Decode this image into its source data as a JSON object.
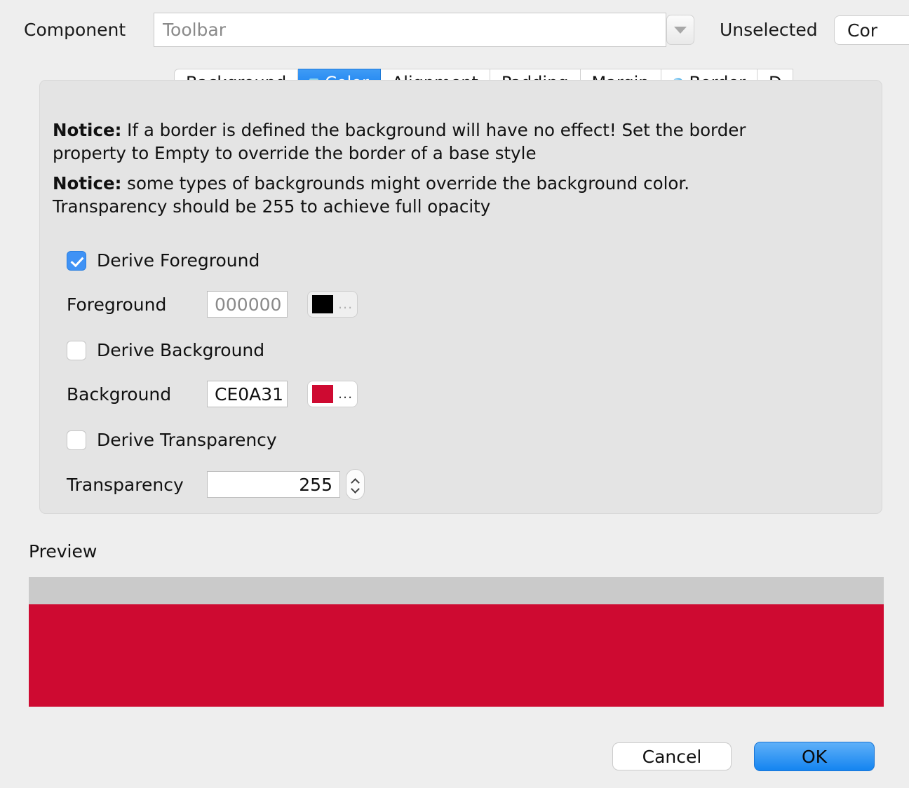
{
  "header": {
    "component_label": "Component",
    "component_value": "Toolbar",
    "dropdown_icon": "chevron-down-icon",
    "state_label": "Unselected",
    "corner_button_label": "Cor"
  },
  "tabs": [
    {
      "label": "Background",
      "active": false,
      "icon": ""
    },
    {
      "label": "Color",
      "active": true,
      "icon": "color-square-icon"
    },
    {
      "label": "Alignment",
      "active": false,
      "icon": ""
    },
    {
      "label": "Padding",
      "active": false,
      "icon": ""
    },
    {
      "label": "Margin",
      "active": false,
      "icon": ""
    },
    {
      "label": "Border",
      "active": false,
      "icon": "border-circle-icon"
    },
    {
      "label": "D",
      "active": false,
      "icon": ""
    }
  ],
  "panel": {
    "notice_1_prefix": "Notice:",
    "notice_1_text": " If a border is defined the background will have no effect! Set the border property to Empty to override the border of a base style",
    "notice_2_prefix": "Notice:",
    "notice_2_text": " some types of backgrounds might override the background color. Transparency should be 255 to achieve full opacity",
    "derive_foreground": {
      "label": "Derive Foreground",
      "checked": true
    },
    "foreground": {
      "label": "Foreground",
      "value": "000000",
      "enabled": false,
      "swatch_color": "#000000",
      "swatch_ellipsis": "...",
      "swatch_icon": "color-picker-button"
    },
    "derive_background": {
      "label": "Derive Background",
      "checked": false
    },
    "background": {
      "label": "Background",
      "value": "CE0A31",
      "enabled": true,
      "swatch_color": "#CE0A31",
      "swatch_ellipsis": "...",
      "swatch_icon": "color-picker-button"
    },
    "derive_transparency": {
      "label": "Derive Transparency",
      "checked": false
    },
    "transparency": {
      "label": "Transparency",
      "value": "255",
      "stepper_up_icon": "chevron-up-icon",
      "stepper_down_icon": "chevron-down-icon"
    }
  },
  "preview": {
    "label": "Preview",
    "bar_color": "#cacaca",
    "body_color": "#ce0a31"
  },
  "footer": {
    "cancel_label": "Cancel",
    "ok_label": "OK"
  },
  "colors": {
    "page_background": "#eeeeee",
    "panel_background": "#e4e4e4",
    "accent_blue": "#1484f0",
    "crimson": "#ce0a31"
  }
}
